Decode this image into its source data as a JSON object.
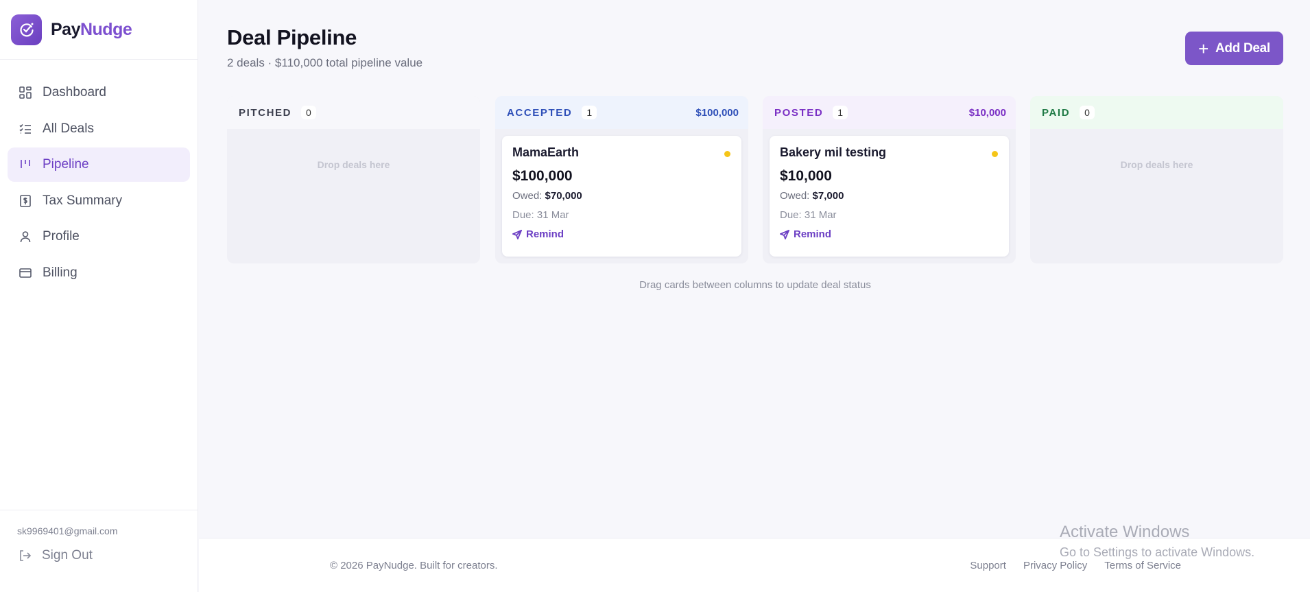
{
  "brand": {
    "name_a": "Pay",
    "name_b": "Nudge",
    "accent": "#7c56c8"
  },
  "sidebar": {
    "items": [
      {
        "label": "Dashboard",
        "icon": "grid-icon"
      },
      {
        "label": "All Deals",
        "icon": "list-check-icon"
      },
      {
        "label": "Pipeline",
        "icon": "kanban-icon",
        "active": true
      },
      {
        "label": "Tax Summary",
        "icon": "receipt-icon"
      },
      {
        "label": "Profile",
        "icon": "user-icon"
      },
      {
        "label": "Billing",
        "icon": "card-icon"
      }
    ],
    "email": "sk9969401@gmail.com",
    "signout": "Sign Out"
  },
  "header": {
    "title": "Deal Pipeline",
    "subtitle": "2 deals · $110,000 total pipeline value",
    "add_label": "Add Deal",
    "add_icon": "plus-icon"
  },
  "columns": [
    {
      "title": "PITCHED",
      "count": "0",
      "total": "",
      "color": "#3c3f4e",
      "head_bg": "#f7f7fb",
      "empty": "Drop deals here"
    },
    {
      "title": "ACCEPTED",
      "count": "1",
      "total": "$100,000",
      "color": "#2e4fb8",
      "head_bg": "#eef3fd",
      "card": {
        "name": "MamaEarth",
        "amount": "$100,000",
        "owed_label": "Owed:",
        "owed": "$70,000",
        "due": "Due: 31 Mar",
        "remind": "Remind"
      }
    },
    {
      "title": "POSTED",
      "count": "1",
      "total": "$10,000",
      "color": "#7a2fc4",
      "head_bg": "#f5f0fc",
      "card": {
        "name": "Bakery mil testing",
        "amount": "$10,000",
        "owed_label": "Owed:",
        "owed": "$7,000",
        "due": "Due: 31 Mar",
        "remind": "Remind"
      }
    },
    {
      "title": "PAID",
      "count": "0",
      "total": "",
      "color": "#1f7a45",
      "head_bg": "#eefaf1",
      "empty": "Drop deals here"
    }
  ],
  "drag_note": "Drag cards between columns to update deal status",
  "footer": {
    "copyright": "© 2026 PayNudge. Built for creators.",
    "links": [
      "Support",
      "Privacy Policy",
      "Terms of Service"
    ]
  },
  "watermark": {
    "line1": "Activate Windows",
    "line2": "Go to Settings to activate Windows."
  }
}
